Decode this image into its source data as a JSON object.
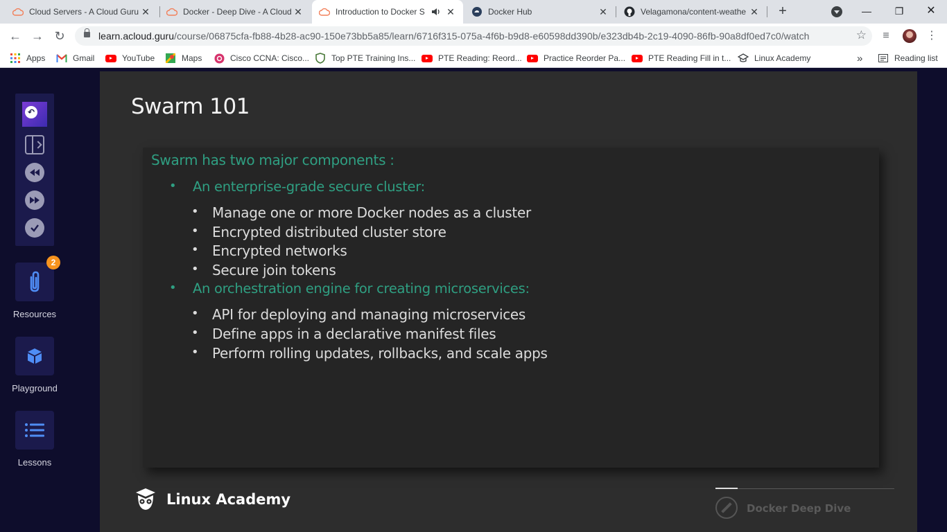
{
  "browser": {
    "tabs": [
      {
        "title": "Cloud Servers - A Cloud Guru",
        "favicon": "acloudguru-cloud-icon",
        "active": false
      },
      {
        "title": "Docker - Deep Dive - A Cloud",
        "favicon": "acloudguru-cloud-icon",
        "active": false
      },
      {
        "title": "Introduction to Docker S",
        "favicon": "acloudguru-cloud-icon",
        "active": true,
        "audio": "speaker-icon"
      },
      {
        "title": "Docker Hub",
        "favicon": "docker-hub-icon",
        "active": false
      },
      {
        "title": "Velagamona/content-weathe",
        "favicon": "github-icon",
        "active": false
      }
    ],
    "new_tab_label": "+",
    "address": {
      "host": "learn.acloud.guru",
      "path": "/course/06875cfa-fb88-4b28-ac90-150e73bb5a85/learn/6716f315-075a-4f6b-b9d8-e60598dd390b/e323db4b-2c19-4090-86fb-90a8df0ed7c0/watch"
    },
    "bookmarks": [
      {
        "label": "Apps",
        "icon": "apps-grid-icon"
      },
      {
        "label": "Gmail",
        "icon": "gmail-icon"
      },
      {
        "label": "YouTube",
        "icon": "youtube-icon"
      },
      {
        "label": "Maps",
        "icon": "maps-icon"
      },
      {
        "label": "Cisco CCNA: Cisco...",
        "icon": "cisco-icon"
      },
      {
        "label": "Top PTE Training Ins...",
        "icon": "shield-icon"
      },
      {
        "label": "PTE Reading: Reord...",
        "icon": "youtube-icon"
      },
      {
        "label": "Practice Reorder Pa...",
        "icon": "youtube-icon"
      },
      {
        "label": "PTE Reading Fill in t...",
        "icon": "youtube-icon"
      },
      {
        "label": "Linux Academy",
        "icon": "graduation-cap-icon"
      }
    ],
    "more_bookmarks": "»",
    "reading_list": "Reading list"
  },
  "sidebar": {
    "resources_label": "Resources",
    "resources_badge": "2",
    "playground_label": "Playground",
    "lessons_label": "Lessons"
  },
  "slide": {
    "title": "Swarm 101",
    "heading": "Swarm has two major components :",
    "sections": [
      {
        "label": "An enterprise-grade secure cluster:",
        "items": [
          "Manage one or more Docker nodes as a cluster",
          "Encrypted distributed cluster store",
          "Encrypted networks",
          "Secure join tokens"
        ]
      },
      {
        "label": "An orchestration engine for creating microservices:",
        "items": [
          "API for deploying and managing microservices",
          "Define apps in a declarative manifest files",
          "Perform rolling updates, rollbacks, and scale apps"
        ]
      }
    ],
    "brand": "Linux Academy",
    "course": "Docker Deep Dive"
  },
  "colors": {
    "accent_green": "#2f9f82",
    "page_bg": "#0e0d2c",
    "sidebar_panel": "#1b1a4c",
    "badge": "#f7931e"
  }
}
